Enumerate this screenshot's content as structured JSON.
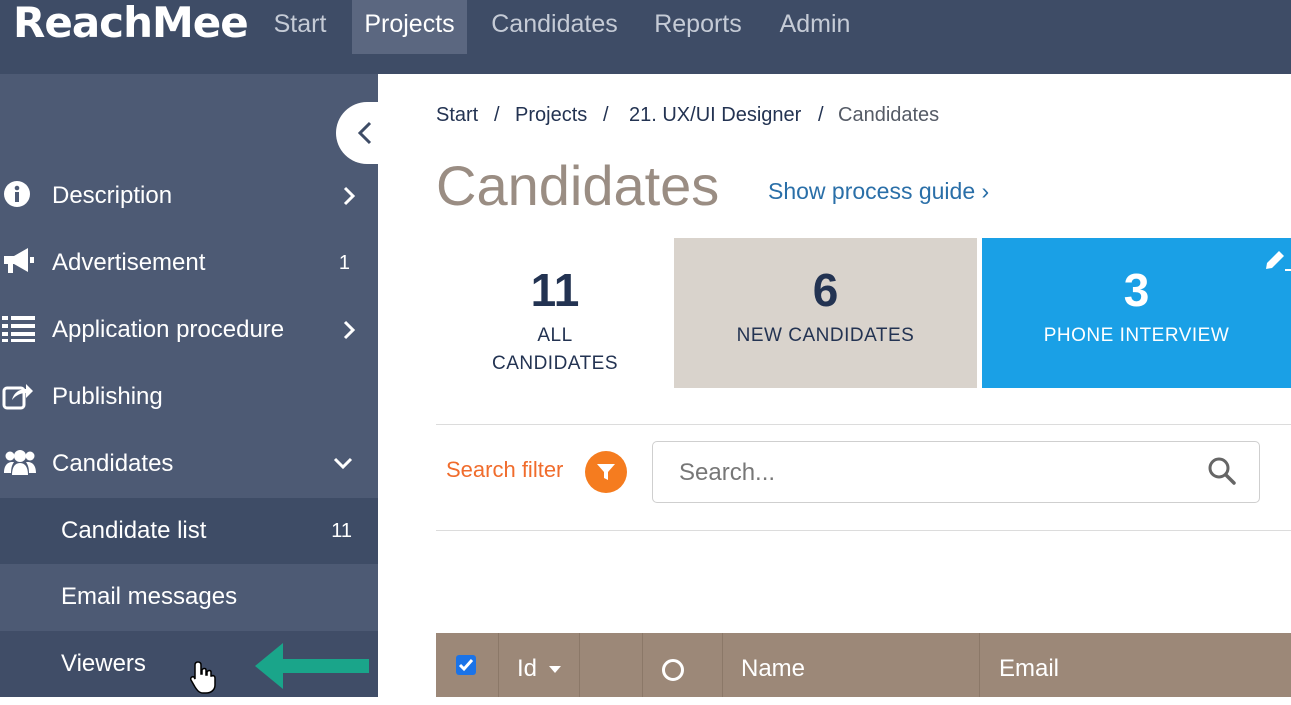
{
  "app": {
    "logo": "ReachMee"
  },
  "nav": {
    "items": [
      {
        "label": "Start",
        "active": false
      },
      {
        "label": "Projects",
        "active": true
      },
      {
        "label": "Candidates",
        "active": false
      },
      {
        "label": "Reports",
        "active": false
      },
      {
        "label": "Admin",
        "active": false
      }
    ]
  },
  "sidebar": {
    "items": [
      {
        "label": "Description",
        "icon": "info-icon",
        "trailing": "chevron-right"
      },
      {
        "label": "Advertisement",
        "icon": "megaphone-icon",
        "count": "1"
      },
      {
        "label": "Application procedure",
        "icon": "list-icon",
        "trailing": "chevron-right"
      },
      {
        "label": "Publishing",
        "icon": "share-icon"
      },
      {
        "label": "Candidates",
        "icon": "users-icon",
        "trailing": "chevron-down"
      }
    ],
    "subitems": [
      {
        "label": "Candidate list",
        "count": "11"
      },
      {
        "label": "Email messages"
      },
      {
        "label": "Viewers"
      }
    ]
  },
  "breadcrumb": {
    "items": [
      "Start",
      "Projects",
      "21. UX/UI Designer",
      "Candidates"
    ],
    "separator": "/"
  },
  "page": {
    "title": "Candidates",
    "process_guide": "Show process guide ›"
  },
  "stats": {
    "all": {
      "number": "11",
      "label_line1": "ALL",
      "label_line2": "CANDIDATES"
    },
    "new": {
      "number": "6",
      "label": "NEW CANDIDATES"
    },
    "phone": {
      "number": "3",
      "label": "PHONE INTERVIEW"
    }
  },
  "search": {
    "filter_label": "Search filter",
    "placeholder": "Search..."
  },
  "table": {
    "columns": {
      "id": "Id",
      "name": "Name",
      "email": "Email"
    }
  },
  "colors": {
    "topbar": "#3e4c66",
    "sidebar": "#4d5a74",
    "accent_orange": "#f57c1f",
    "phone_stage": "#1aa0e6",
    "table_header": "#9c8878",
    "annotation_arrow": "#1aa58a"
  }
}
